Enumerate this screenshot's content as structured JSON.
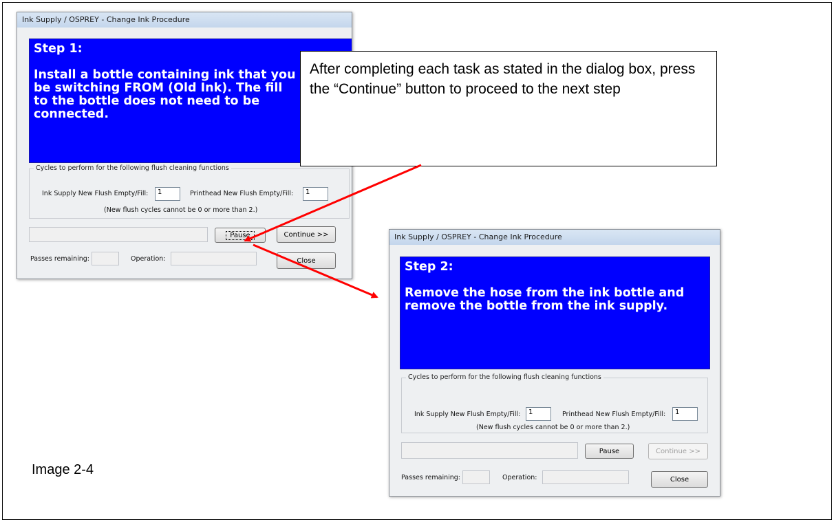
{
  "dialog1": {
    "title": "Ink Supply / OSPREY - Change Ink Procedure",
    "step": "Step 1:",
    "message": "Install a bottle containing ink that you\nbe switching FROM (Old Ink).  The fill\nto the bottle does not need to be\nconnected.",
    "group_legend": "Cycles to perform for the following flush cleaning functions",
    "ink_supply_label": "Ink Supply New Flush Empty/Fill:",
    "ink_supply_value": "1",
    "printhead_label": "Printhead New Flush Empty/Fill:",
    "printhead_value": "1",
    "note": "(New flush cycles cannot be 0 or more than 2.)",
    "pause_label": "Pause",
    "continue_label": "Continue >>",
    "passes_label": "Passes remaining:",
    "operation_label": "Operation:",
    "close_label": "Close"
  },
  "dialog2": {
    "title": "Ink Supply / OSPREY - Change Ink Procedure",
    "step": "Step 2:",
    "message": "Remove the hose from the ink bottle and\nremove the bottle from the ink supply.",
    "group_legend": "Cycles to perform for the following flush cleaning functions",
    "ink_supply_label": "Ink Supply New Flush Empty/Fill:",
    "ink_supply_value": "1",
    "printhead_label": "Printhead New Flush Empty/Fill:",
    "printhead_value": "1",
    "note": "(New flush cycles cannot be 0 or more than 2.)",
    "pause_label": "Pause",
    "continue_label": "Continue >>",
    "continue_enabled": false,
    "passes_label": "Passes remaining:",
    "operation_label": "Operation:",
    "close_label": "Close"
  },
  "callout": {
    "text": "After completing each task as stated in the dialog box, press the “Continue” button to proceed to the next step"
  },
  "caption": "Image 2-4",
  "colors": {
    "step_panel": "#0000ff",
    "arrow": "#ff0000"
  }
}
